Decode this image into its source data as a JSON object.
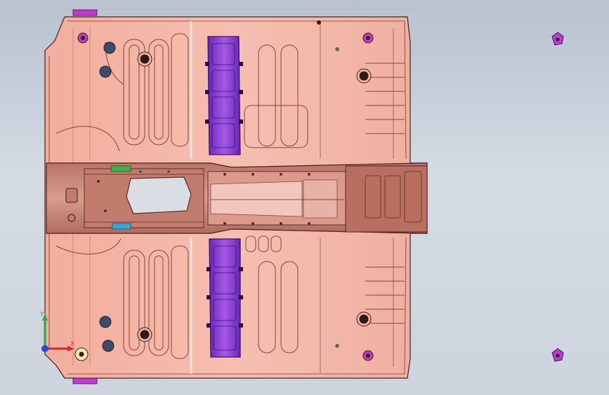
{
  "view": {
    "type": "cad-3d-model-viewport",
    "subject": "vehicle-floor-pan-assembly",
    "background_colors": [
      "#b9c1cf",
      "#d5dbe4"
    ]
  },
  "colors": {
    "panel": "#f4b7a8",
    "panel_edge": "#5a2a22",
    "tunnel": "#c98a7c",
    "tunnel_dark": "#a4675c",
    "crossmember": "#9b4fd6",
    "crossmember_dark": "#5a1f96",
    "bracket_green": "#3fb34a",
    "bracket_blue": "#3aa6d8",
    "marker_magenta": "#c03cc8"
  },
  "triad": {
    "icon": "coordinate-axes-icon",
    "x_label": "X",
    "y_label": "Y",
    "x_color": "#d62a2a",
    "y_color": "#29a84a",
    "z_color": "#2a4ad6"
  }
}
